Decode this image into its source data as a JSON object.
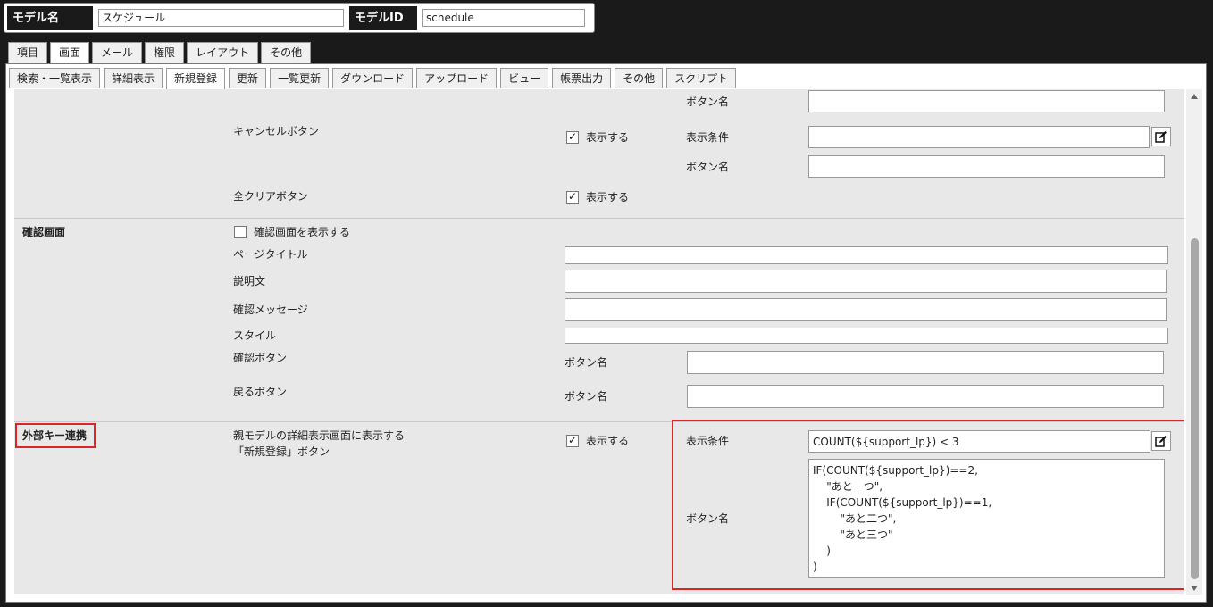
{
  "header": {
    "model_name_label": "モデル名",
    "model_name_value": "スケジュール",
    "model_id_label": "モデルID",
    "model_id_value": "schedule"
  },
  "main_tabs": [
    {
      "label": "項目",
      "active": false
    },
    {
      "label": "画面",
      "active": true
    },
    {
      "label": "メール",
      "active": false
    },
    {
      "label": "権限",
      "active": false
    },
    {
      "label": "レイアウト",
      "active": false
    },
    {
      "label": "その他",
      "active": false
    }
  ],
  "sub_tabs": [
    {
      "label": "検索・一覧表示",
      "active": false
    },
    {
      "label": "詳細表示",
      "active": false
    },
    {
      "label": "新規登録",
      "active": true
    },
    {
      "label": "更新",
      "active": false
    },
    {
      "label": "一覧更新",
      "active": false
    },
    {
      "label": "ダウンロード",
      "active": false
    },
    {
      "label": "アップロード",
      "active": false
    },
    {
      "label": "ビュー",
      "active": false
    },
    {
      "label": "帳票出力",
      "active": false
    },
    {
      "label": "その他",
      "active": false
    },
    {
      "label": "スクリプト",
      "active": false
    }
  ],
  "buttons_section": {
    "top_button_name_label": "ボタン名",
    "cancel_button_label": "キャンセルボタン",
    "cancel_show_label": "表示する",
    "cancel_show_checked": true,
    "cancel_condition_label": "表示条件",
    "cancel_button_name_label": "ボタン名",
    "clear_all_button_label": "全クリアボタン",
    "clear_all_show_label": "表示する",
    "clear_all_show_checked": true
  },
  "confirm_section": {
    "title": "確認画面",
    "show_confirm_label": "確認画面を表示する",
    "show_confirm_checked": false,
    "page_title_label": "ページタイトル",
    "description_label": "説明文",
    "confirm_message_label": "確認メッセージ",
    "style_label": "スタイル",
    "confirm_button_label": "確認ボタン",
    "confirm_button_name_label": "ボタン名",
    "back_button_label": "戻るボタン",
    "back_button_name_label": "ボタン名"
  },
  "fk_section": {
    "title": "外部キー連携",
    "description_line1": "親モデルの詳細表示画面に表示する",
    "description_line2": "「新規登録」ボタン",
    "show_label": "表示する",
    "show_checked": true,
    "condition_label": "表示条件",
    "condition_value": "COUNT(${support_lp}) < 3",
    "button_name_label": "ボタン名",
    "button_name_value": "IF(COUNT(${support_lp})==2,\n    \"あと一つ\",\n    IF(COUNT(${support_lp})==1,\n        \"あと二つ\",\n        \"あと三つ\"\n    )\n)"
  },
  "colors": {
    "highlight": "#d9262b",
    "background": "#1a1a1a",
    "panel": "#e8e8e8"
  }
}
